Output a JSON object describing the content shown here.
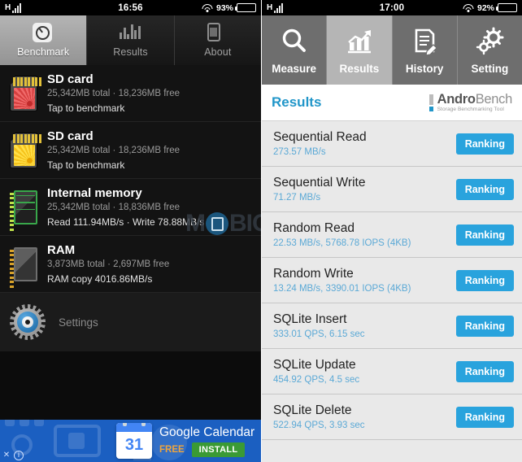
{
  "left": {
    "statusbar": {
      "signal_icon": "signal-bars-icon",
      "time": "16:56",
      "wifi_icon": "wifi-icon",
      "battery_percent": "93%"
    },
    "tabs": [
      {
        "label": "Benchmark",
        "icon": "gauge-icon",
        "active": true
      },
      {
        "label": "Results",
        "icon": "bar-chart-icon",
        "active": false
      },
      {
        "label": "About",
        "icon": "phone-icon",
        "active": false
      }
    ],
    "items": [
      {
        "icon": "sd-card-red-icon",
        "title": "SD card",
        "sub": "25,342MB total · 18,236MB free",
        "action": "Tap to benchmark"
      },
      {
        "icon": "sd-card-yellow-icon",
        "title": "SD card",
        "sub": "25,342MB total · 18,236MB free",
        "action": "Tap to benchmark"
      },
      {
        "icon": "memory-chip-green-icon",
        "title": "Internal memory",
        "sub": "25,342MB total · 18,836MB free",
        "action": "Read 111.94MB/s · Write 78.88MB/s"
      },
      {
        "icon": "memory-chip-gray-icon",
        "title": "RAM",
        "sub": "3,873MB total · 2,697MB free",
        "action": "RAM copy 4016.86MB/s"
      }
    ],
    "settings": {
      "label": "Settings",
      "icon": "gear-eye-icon"
    },
    "watermark": {
      "part1": "M",
      "part2": "BIG"
    },
    "ad": {
      "day_number": "31",
      "title": "Google Calendar",
      "price_label": "FREE",
      "install_label": "INSTALL",
      "close_icon": "ad-close-icon",
      "info_icon": "ad-info-icon"
    }
  },
  "right": {
    "statusbar": {
      "signal_icon": "signal-bars-icon",
      "time": "17:00",
      "wifi_icon": "wifi-icon",
      "battery_percent": "92%"
    },
    "tabs": [
      {
        "label": "Measure",
        "icon": "magnifier-icon",
        "active": false
      },
      {
        "label": "Results",
        "icon": "growth-chart-icon",
        "active": true
      },
      {
        "label": "History",
        "icon": "document-pencil-icon",
        "active": false
      },
      {
        "label": "Setting",
        "icon": "gears-icon",
        "active": false
      }
    ],
    "header": {
      "title": "Results",
      "brand_name_1": "Andro",
      "brand_name_2": "Bench",
      "brand_tagline": "Storage Benchmarking Tool"
    },
    "ranking_label": "Ranking",
    "results": [
      {
        "name": "Sequential Read",
        "value": "273.57 MB/s"
      },
      {
        "name": "Sequential Write",
        "value": "71.27 MB/s"
      },
      {
        "name": "Random Read",
        "value": "22.53 MB/s, 5768.78 IOPS (4KB)"
      },
      {
        "name": "Random Write",
        "value": "13.24 MB/s, 3390.01 IOPS (4KB)"
      },
      {
        "name": "SQLite Insert",
        "value": "333.01 QPS, 6.15 sec"
      },
      {
        "name": "SQLite Update",
        "value": "454.92 QPS, 4.5 sec"
      },
      {
        "name": "SQLite Delete",
        "value": "522.94 QPS, 3.93 sec"
      }
    ]
  },
  "colors": {
    "accent_blue": "#29a3dd",
    "title_blue": "#2196c9",
    "ad_blue": "#1b5fc1",
    "install_green": "#3a9a35"
  }
}
